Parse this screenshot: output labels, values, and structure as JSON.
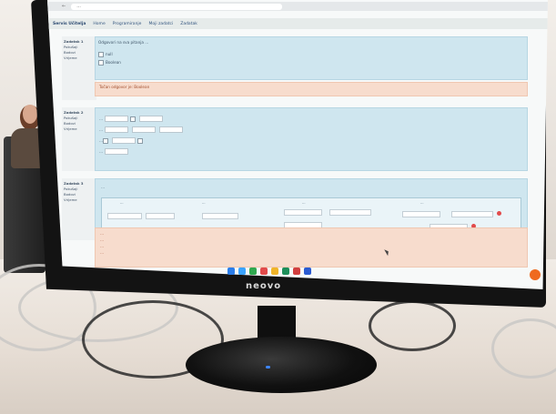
{
  "monitor": {
    "brand": "neovo"
  },
  "browser": {
    "url": "...",
    "tab_label": ""
  },
  "navbar": {
    "brand": "Servis Učitelja",
    "items": [
      "Home",
      "Programiranje",
      "Moji zadatci",
      "Zadatak"
    ]
  },
  "section1": {
    "sidebar": [
      "Zadatak 1",
      "Pokušaji",
      "Bodovi",
      "Vrijeme"
    ],
    "question": "Odgovori na sva pitanja ...",
    "options": [
      "null",
      "Boolean"
    ],
    "feedback": "Točan odgovor je: Boolean"
  },
  "section2": {
    "sidebar": [
      "Zadatak 2",
      "Pokušaji",
      "Bodovi",
      "Vrijeme"
    ],
    "lines": [
      "...",
      "...",
      "...",
      "..."
    ]
  },
  "section3": {
    "sidebar": [
      "Zadatak 3",
      "Pokušaji",
      "Bodovi",
      "Vrijeme"
    ],
    "title": "...",
    "columns": [
      "...",
      "...",
      "...",
      "..."
    ],
    "feedback_lines": [
      "...",
      "...",
      "...",
      "..."
    ]
  },
  "tray": {
    "time": "",
    "date": ""
  },
  "colors": {
    "panel_blue": "#cfe6ef",
    "panel_peach": "#f7dccd",
    "accent_orange": "#ef6a1f"
  }
}
